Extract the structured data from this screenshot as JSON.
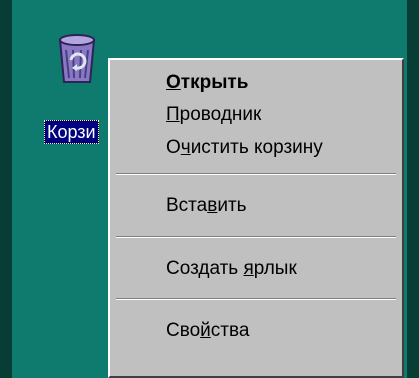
{
  "desktop": {
    "background_color": "#0f7a6e",
    "icon": {
      "name": "recycle-bin-icon",
      "label": "Корзина",
      "label_visible_part": "Корзи"
    }
  },
  "context_menu": {
    "items": [
      {
        "label": "Открыть",
        "before": "",
        "accel": "О",
        "after": "ткрыть",
        "default": true
      },
      {
        "label": "Проводник",
        "before": "",
        "accel": "П",
        "after": "роводник"
      },
      {
        "label": "Очистить корзину",
        "before": "О",
        "accel": "ч",
        "after": "истить корзину"
      },
      {
        "label": "Вставить",
        "before": "Вста",
        "accel": "в",
        "after": "ить"
      },
      {
        "label": "Создать ярлык",
        "before": "Создать ",
        "accel": "я",
        "after": "рлык"
      },
      {
        "label": "Свойства",
        "before": "Сво",
        "accel": "й",
        "after": "ства"
      }
    ]
  }
}
